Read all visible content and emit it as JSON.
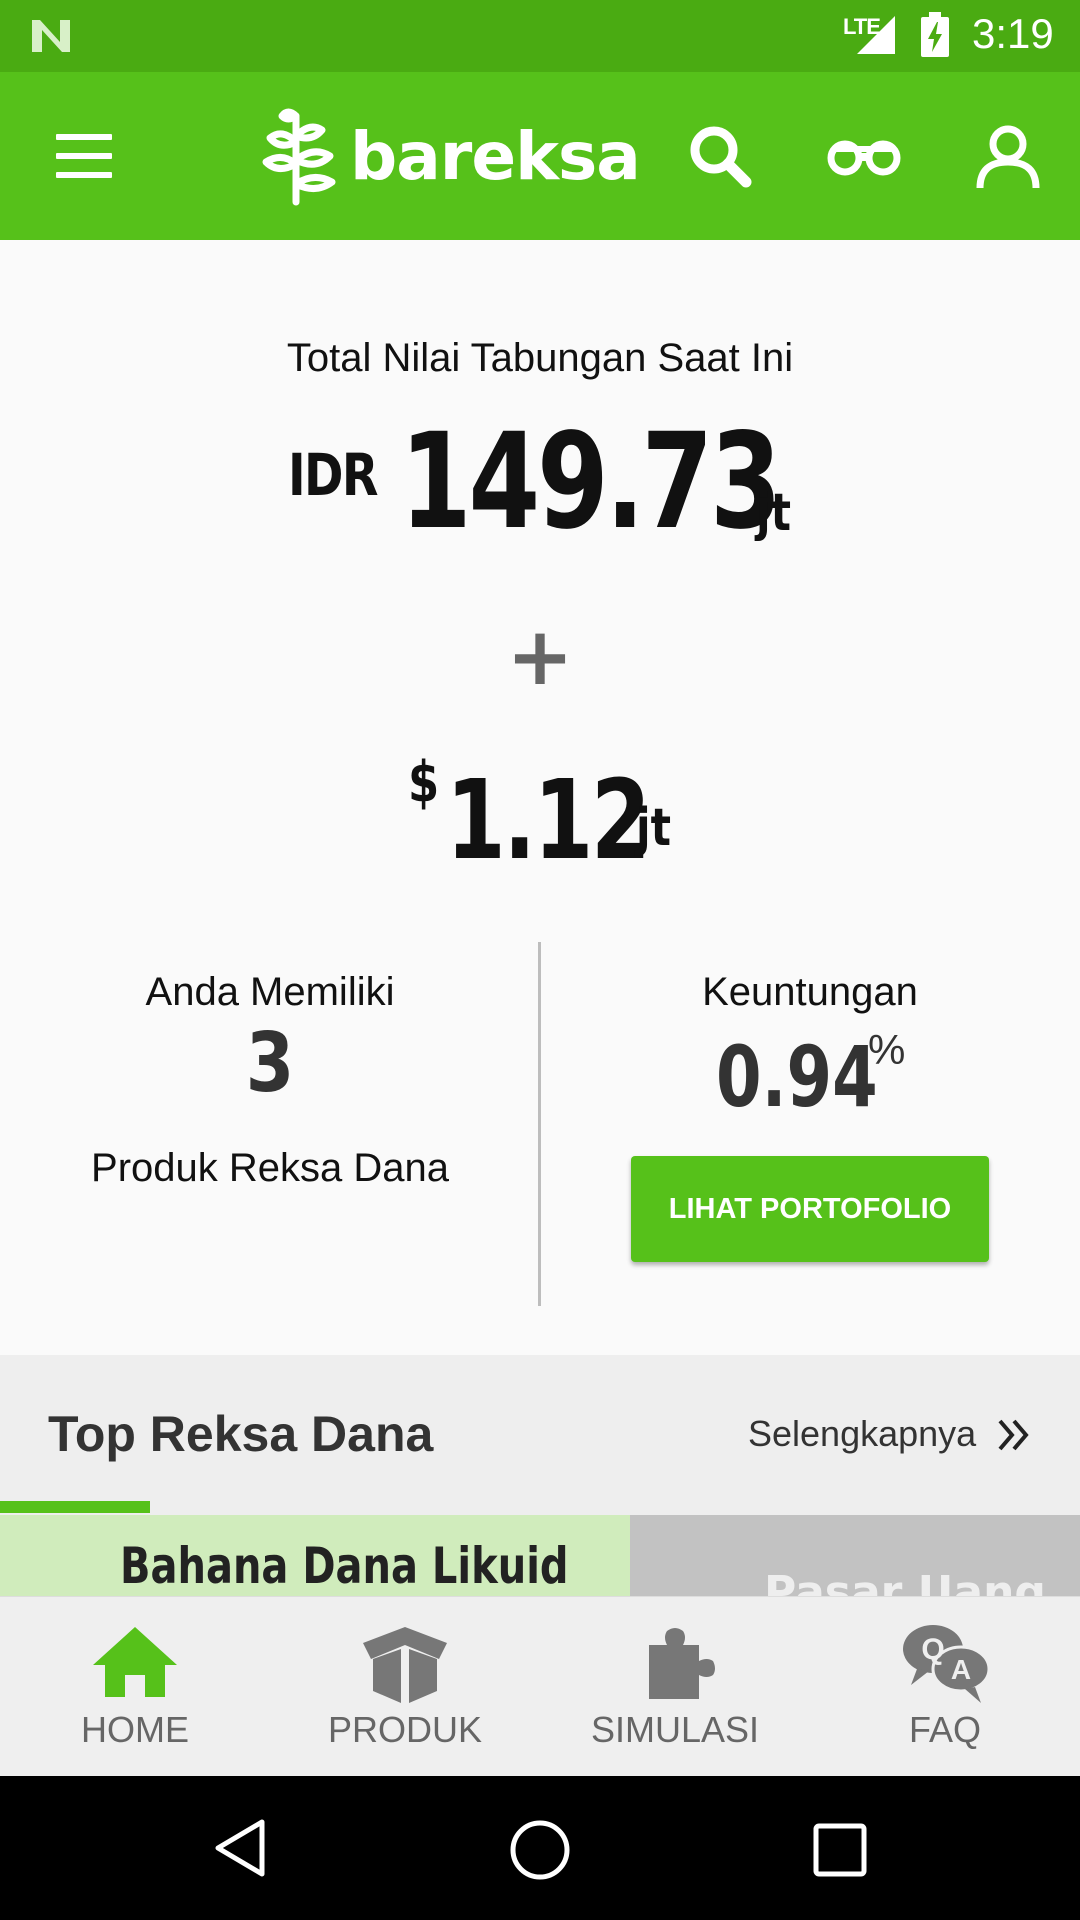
{
  "status_bar": {
    "network": "LTE",
    "time": "3:19"
  },
  "app_bar": {
    "brand": "bareksa",
    "icons": [
      "menu-icon",
      "search-icon",
      "binoculars-icon",
      "profile-icon"
    ]
  },
  "summary": {
    "total_label": "Total Nilai Tabungan Saat Ini",
    "idr_currency": "IDR",
    "idr_value": "149.73",
    "idr_unit": "jt",
    "plus": "+",
    "usd_currency": "$",
    "usd_value": "1.12",
    "usd_unit": "jt"
  },
  "holdings": {
    "label": "Anda Memiliki",
    "count": "3",
    "sub_label": "Produk Reksa Dana"
  },
  "profit": {
    "label": "Keuntungan",
    "value": "0.94",
    "unit": "%",
    "button_label": "LIHAT PORTOFOLIO"
  },
  "top_reksa_dana": {
    "title": "Top Reksa Dana",
    "more_label": "Selengkapnya",
    "tabs": [
      {
        "label": "Bahana Dana Likuid"
      },
      {
        "label": "Pasar Uang"
      }
    ]
  },
  "bottom_nav": {
    "items": [
      {
        "label": "HOME",
        "icon": "home-icon",
        "active": true
      },
      {
        "label": "PRODUK",
        "icon": "box-icon",
        "active": false
      },
      {
        "label": "SIMULASI",
        "icon": "puzzle-icon",
        "active": false
      },
      {
        "label": "FAQ",
        "icon": "qa-icon",
        "active": false
      }
    ]
  },
  "colors": {
    "status_bar": "#4aab12",
    "brand_green": "#56c11a",
    "tab_active_bg": "#d0ecbc",
    "tab_inactive_bg": "#c2c2c2"
  }
}
